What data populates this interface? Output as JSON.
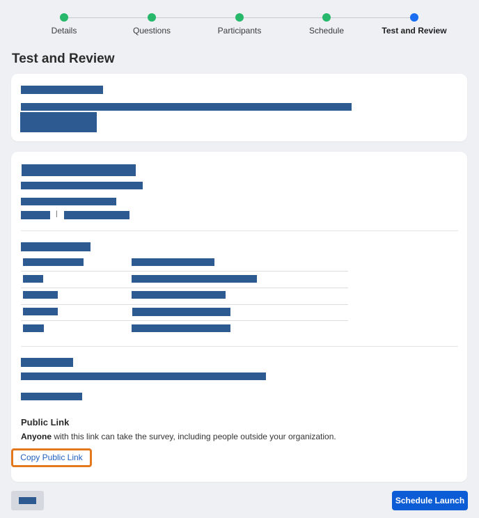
{
  "stepper": {
    "steps": [
      {
        "label": "Details",
        "status": "complete"
      },
      {
        "label": "Questions",
        "status": "complete"
      },
      {
        "label": "Participants",
        "status": "complete"
      },
      {
        "label": "Schedule",
        "status": "complete"
      },
      {
        "label": "Test and Review",
        "status": "current"
      }
    ],
    "colors": {
      "complete": "#28b86b",
      "current": "#1a6df0"
    }
  },
  "page": {
    "title": "Test and Review"
  },
  "public_link": {
    "title": "Public Link",
    "desc_bold": "Anyone",
    "desc_rest": " with this link can take the survey, including people outside your organization.",
    "copy_label": "Copy Public Link"
  },
  "footer": {
    "launch_label": "Schedule Launch"
  },
  "colors": {
    "accent": "#0b5cd5",
    "highlight_border": "#e2791f",
    "redaction": "#2e5a92"
  }
}
